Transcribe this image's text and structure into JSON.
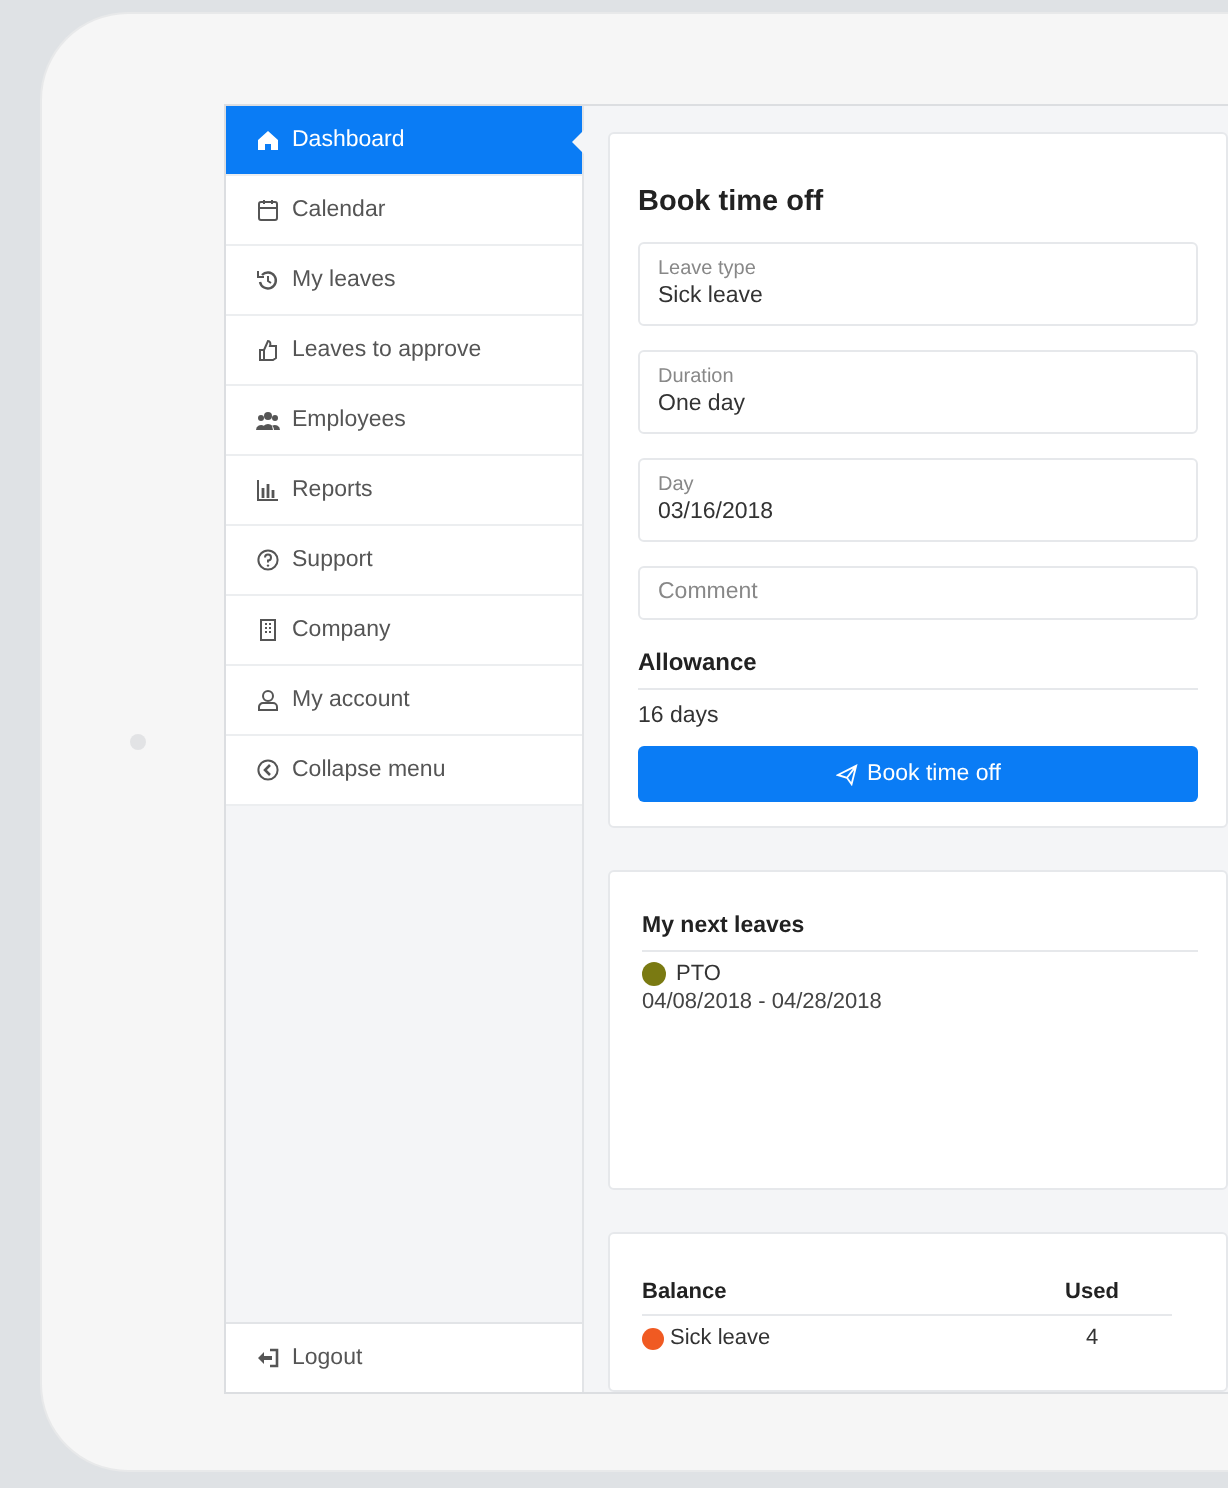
{
  "sidebar": {
    "items": [
      {
        "label": "Dashboard",
        "selected": true
      },
      {
        "label": "Calendar",
        "selected": false
      },
      {
        "label": "My leaves",
        "selected": false
      },
      {
        "label": "Leaves to approve",
        "selected": false
      },
      {
        "label": "Employees",
        "selected": false
      },
      {
        "label": "Reports",
        "selected": false
      },
      {
        "label": "Support",
        "selected": false
      },
      {
        "label": "Company",
        "selected": false
      },
      {
        "label": "My account",
        "selected": false
      },
      {
        "label": "Collapse menu",
        "selected": false
      }
    ],
    "logout": "Logout"
  },
  "book_time_off": {
    "title": "Book time off",
    "fields": [
      {
        "label": "Leave type",
        "value": "Sick leave"
      },
      {
        "label": "Duration",
        "value": "One day"
      },
      {
        "label": "Day",
        "value": "03/16/2018"
      },
      {
        "placeholder": "Comment"
      }
    ],
    "allowance": {
      "label": "Allowance",
      "value": "16 days"
    },
    "button": "Book time off"
  },
  "next_leaves": {
    "title": "My next leaves",
    "items": [
      {
        "type": "PTO",
        "dates": "04/08/2018 - 04/28/2018",
        "color": "#7a7a12"
      }
    ]
  },
  "balance": {
    "columns": [
      "Balance",
      "Used"
    ],
    "rows": [
      {
        "name": "Sick leave",
        "used": "4",
        "color": "#f05a22"
      }
    ]
  }
}
